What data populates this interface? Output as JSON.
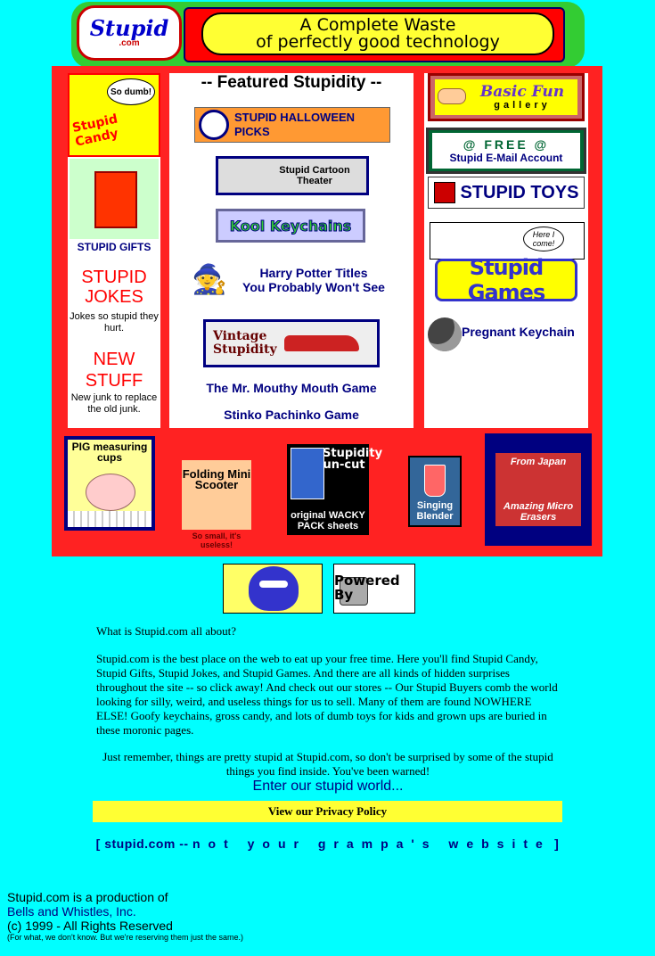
{
  "header": {
    "logo_word": "Stupid",
    "logo_domain": ".com",
    "tagline_line1": "A Complete Waste",
    "tagline_line2": "of perfectly good technology"
  },
  "featured": {
    "heading": "-- Featured Stupidity --",
    "halloween": "STUPID HALLOWEEN PICKS",
    "cartoon": "Stupid Cartoon Theater",
    "keychains": "Kool Keychains",
    "potter_line1": "Harry Potter Titles",
    "potter_line2": "You Probably Won't See",
    "vintage_line1": "Vintage",
    "vintage_line2": "Stupidity",
    "mouthy": "The Mr. Mouthy Mouth Game",
    "pachinko": "Stinko Pachinko Game"
  },
  "left": {
    "candy_bubble": "So dumb!",
    "candy_label": "Stupid Candy",
    "gifts_label": "STUPID GIFTS",
    "jokes_title": "STUPID JOKES",
    "jokes_sub": "Jokes so stupid they hurt.",
    "new_title": "NEW STUFF",
    "new_sub": "New junk to replace the old junk."
  },
  "right": {
    "basicfun_title": "Basic Fun",
    "basicfun_sub": "gallery",
    "email_line1": "@ FREE @",
    "email_line2": "Stupid E-Mail Account",
    "toys": "STUPID TOYS",
    "herecome_bubble": "Here I come!",
    "games": "Stupid Games",
    "pregnant": "Pregnant  Keychain"
  },
  "bottom": {
    "pig_title": "PIG measuring cups",
    "scooter_title": "Folding Mini Scooter",
    "scooter_note": "So small, it's useless!",
    "wacky_top": "Stupidity un-cut",
    "wacky_bottom": "original WACKY PACK sheets",
    "blender": "Singing Blender",
    "erasers_top": "From Japan",
    "erasers_bottom": "Amazing Micro Erasers"
  },
  "powered_by": "Powered By",
  "about": {
    "question": "What is Stupid.com all about?",
    "paragraph": "Stupid.com is the best place on the web to eat up your free time. Here you'll find Stupid Candy, Stupid Gifts, Stupid Jokes, and Stupid Games. And there are all kinds of hidden surprises throughout the site -- so click away! And check out our stores -- Our Stupid Buyers comb the world looking for silly, weird, and useless things for us to sell. Many of them are found NOWHERE ELSE! Goofy keychains, gross candy, and lots of dumb  toys for kids and grown ups are buried in these moronic pages.",
    "remember": "Just remember, things are pretty stupid at Stupid.com, so don't be surprised by some of the stupid things you find inside. You've been warned!",
    "enter": "Enter our stupid world...",
    "privacy": "View our Privacy Policy"
  },
  "footer": {
    "tag_start": "[ stupid.com -- ",
    "tag_spaced": "not your grampa's website",
    "tag_end": " ]",
    "credits_line1": "Stupid.com is a production of",
    "credits_company": "Bells and Whistles, Inc.",
    "credits_rights": "(c) 1999 - All Rights Reserved",
    "credits_small": "(For what, we don't know. But we're reserving them just the same.)"
  },
  "colors": {
    "background": "#00ffff",
    "panel": "#ff2222",
    "accent_navy": "#000080",
    "highlight_yellow": "#ffff33"
  }
}
